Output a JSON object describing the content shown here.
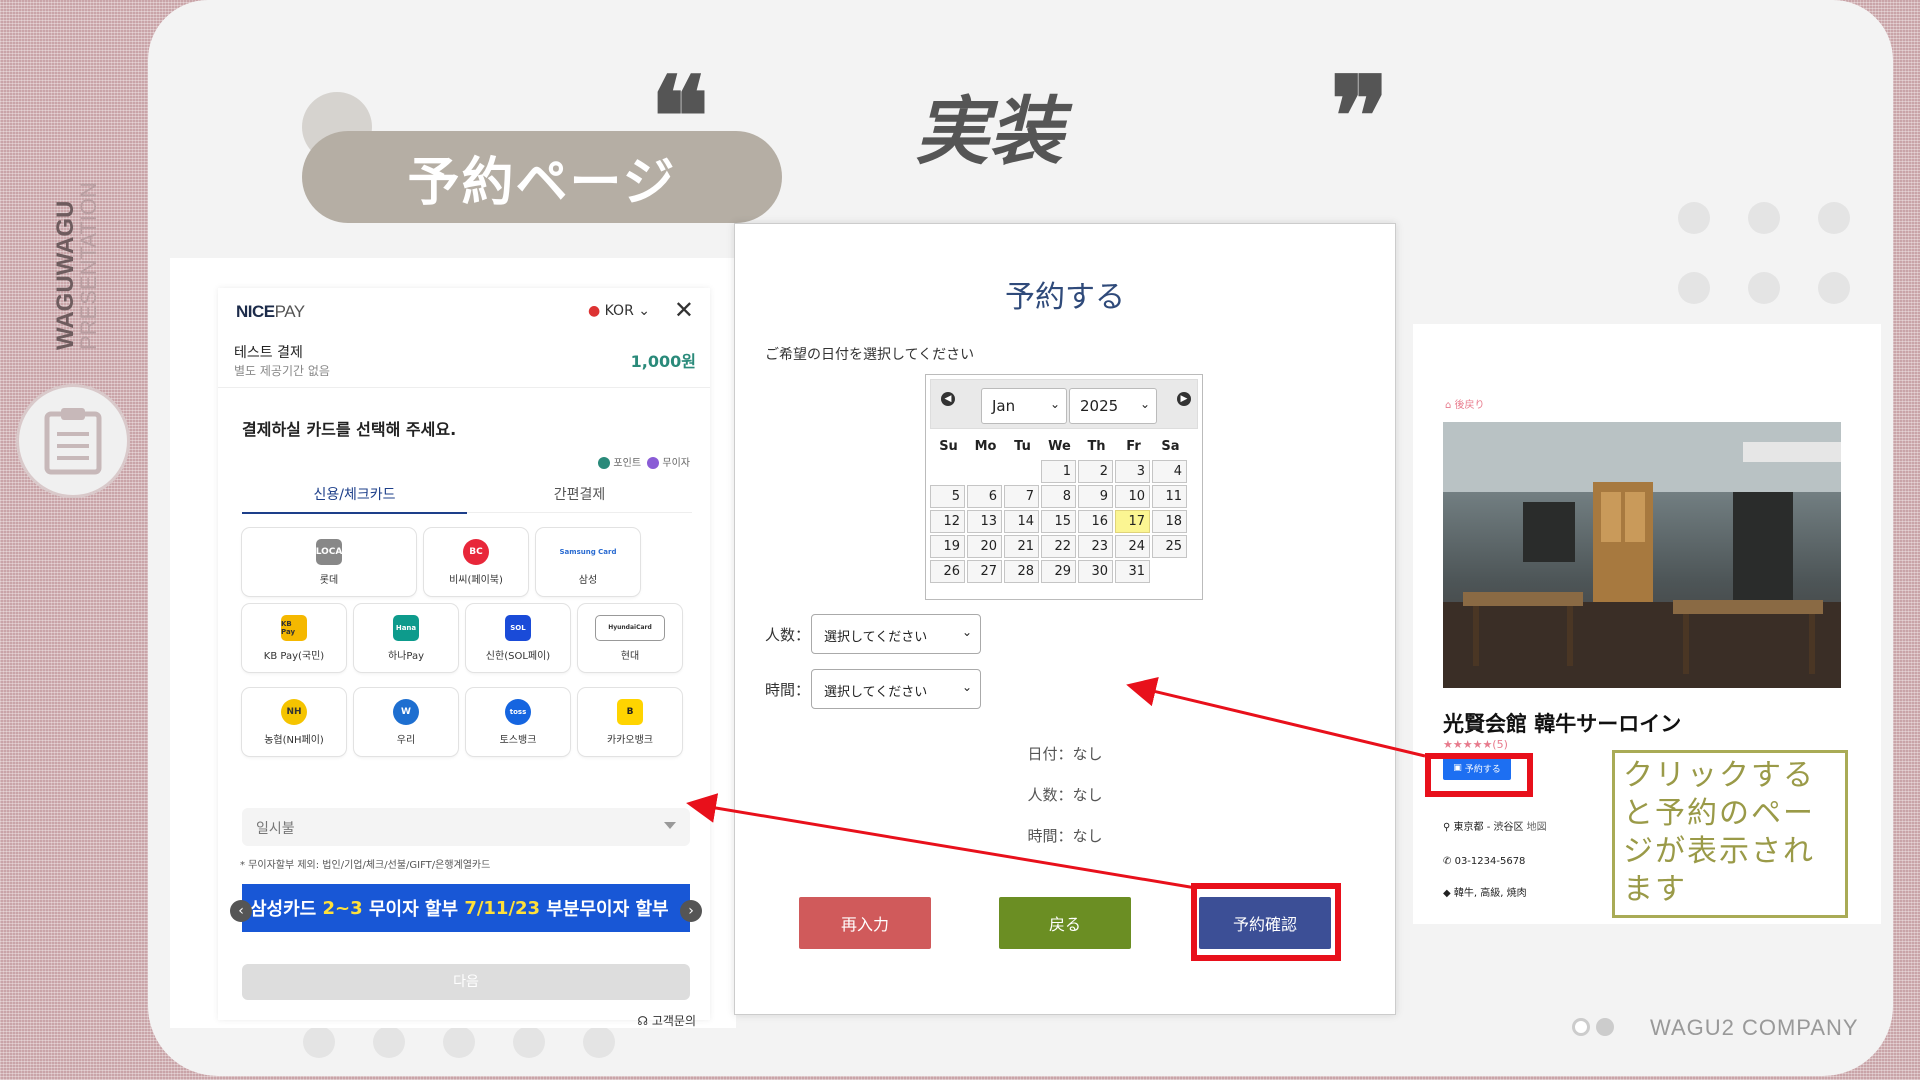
{
  "side": {
    "vertical_title": "WAGUWAGU",
    "vertical_subtitle": "PRESENTATION"
  },
  "slide": {
    "section_pill": "予約ページ",
    "heading": "実装",
    "open_quote": "❝",
    "close_quote": "❞",
    "company": "WAGU2 COMPANY"
  },
  "nicepay": {
    "logo_bold": "NICE",
    "logo_light": "PAY",
    "language": "KOR",
    "close": "✕",
    "payment_title": "테스트 결제",
    "payment_sub": "별도 제공기간 없음",
    "amount": "1,000원",
    "instruction": "결제하실 카드를 선택해 주세요.",
    "legend_point": "포인트",
    "legend_free": "무이자",
    "tabs": [
      "신용/체크카드",
      "간편결제"
    ],
    "cards": [
      {
        "label": "롯데",
        "icon": "LOCA",
        "color": "#555555"
      },
      {
        "label": "비씨(페이북)",
        "icon": "BC",
        "color": "#e8273a"
      },
      {
        "label": "삼성",
        "icon": "Samsung Card",
        "color": "#2a6bd1"
      },
      {
        "label": "KB Pay(국민)",
        "icon": "KB Pay",
        "color": "#f5b800"
      },
      {
        "label": "하나Pay",
        "icon": "Hana",
        "color": "#0d9b8c"
      },
      {
        "label": "신한(SOL페이)",
        "icon": "SOL",
        "color": "#1a4bd8"
      },
      {
        "label": "현대",
        "icon": "HyundaiCard",
        "color": "#333333"
      },
      {
        "label": "농협(NH페이)",
        "icon": "NH",
        "color": "#f5c400"
      },
      {
        "label": "우리",
        "icon": "W",
        "color": "#1e6fd0"
      },
      {
        "label": "토스뱅크",
        "icon": "toss",
        "color": "#1565e0"
      },
      {
        "label": "카카오뱅크",
        "icon": "B",
        "color": "#ffd400"
      }
    ],
    "installment": "일시불",
    "note": "* 무이자할부 제외: 법인/기업/체크/선불/GIFT/은행계열카드",
    "banner_prefix": "삼성카드",
    "banner_hl1": "2~3",
    "banner_mid": "무이자 할부",
    "banner_hl2": "7/11/23",
    "banner_suffix": "부분무이자 할부",
    "next": "다음",
    "support": "고객문의"
  },
  "reservation": {
    "title": "予約する",
    "date_prompt": "ご希望の日付を選択してください",
    "month": "Jan",
    "year": "2025",
    "weekdays": [
      "Su",
      "Mo",
      "Tu",
      "We",
      "Th",
      "Fr",
      "Sa"
    ],
    "days": [
      "",
      "",
      "",
      "1",
      "2",
      "3",
      "4",
      "5",
      "6",
      "7",
      "8",
      "9",
      "10",
      "11",
      "12",
      "13",
      "14",
      "15",
      "16",
      "17",
      "18",
      "19",
      "20",
      "21",
      "22",
      "23",
      "24",
      "25",
      "26",
      "27",
      "28",
      "29",
      "30",
      "31"
    ],
    "highlighted_day": "17",
    "people_label": "人数：",
    "people_placeholder": "選択してください",
    "time_label": "時間：",
    "time_placeholder": "選択してください",
    "summary_date": "日付：なし",
    "summary_people": "人数：なし",
    "summary_time": "時間：なし",
    "btn_reenter": "再入力",
    "btn_back": "戻る",
    "btn_confirm": "予約確認",
    "colors": {
      "reenter": "#d05a5b",
      "back": "#6b8e23",
      "confirm": "#3c4f96"
    }
  },
  "restaurant": {
    "back": "後戻り",
    "name": "光賢会館 韓牛サーロイン",
    "stars": "★★★★★(5)",
    "reserve": "予約する",
    "address": "東京都 - 渋谷区",
    "map": "地図",
    "phone": "03-1234-5678",
    "tags": "韓牛, 高級, 焼肉"
  },
  "callout": "クリックすると予約のページが表示されます"
}
